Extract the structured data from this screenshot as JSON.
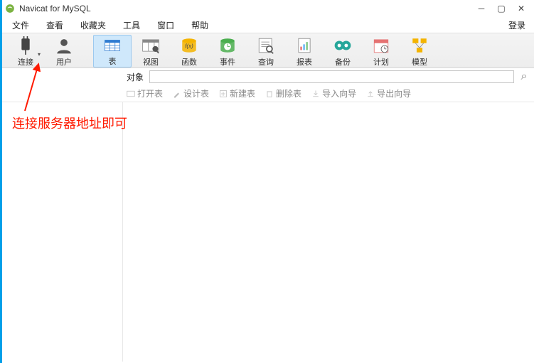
{
  "title": "Navicat for MySQL",
  "menu": {
    "file": "文件",
    "view": "查看",
    "fav": "收藏夹",
    "tool": "工具",
    "win": "窗口",
    "help": "帮助"
  },
  "login": "登录",
  "toolbar": {
    "connect": "连接",
    "user": "用户",
    "table": "表",
    "view": "视图",
    "func": "函数",
    "event": "事件",
    "query": "查询",
    "report": "报表",
    "backup": "备份",
    "schedule": "计划",
    "model": "模型"
  },
  "sub": {
    "object": "对象"
  },
  "search": {
    "placeholder": ""
  },
  "actions": {
    "open": "打开表",
    "design": "设计表",
    "new": "新建表",
    "delete": "删除表",
    "import": "导入向导",
    "export": "导出向导"
  },
  "annotation": "连接服务器地址即可"
}
